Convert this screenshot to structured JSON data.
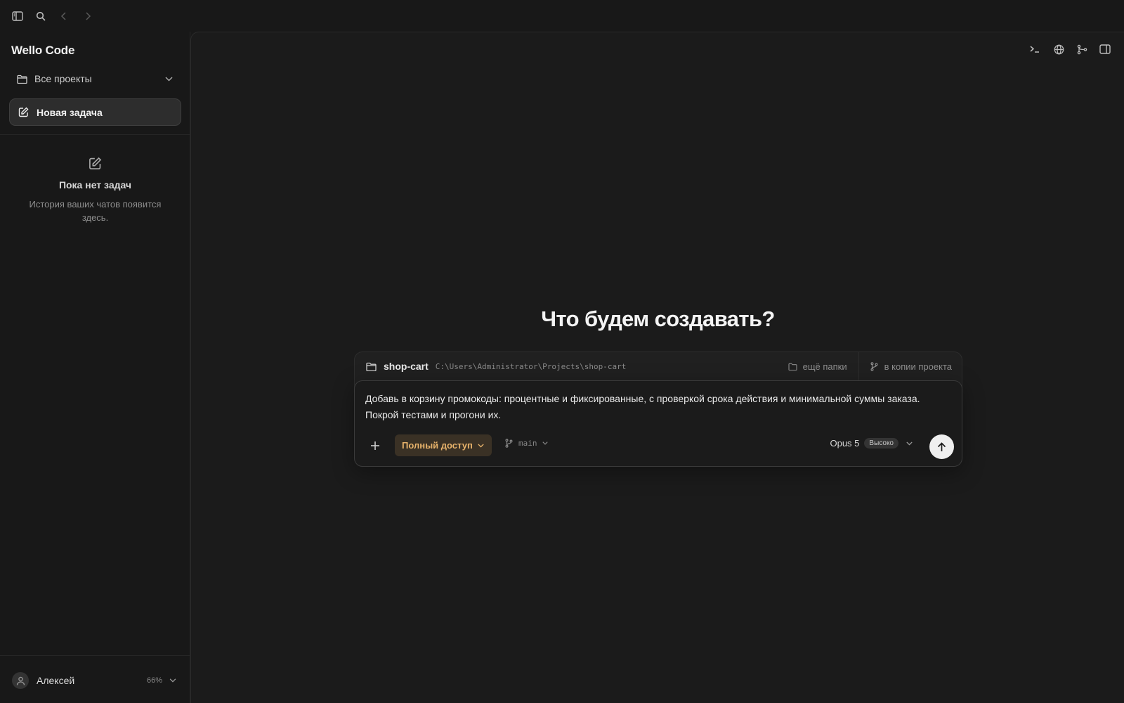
{
  "app": {
    "brand": "Wello Code"
  },
  "topbar": {
    "icons": [
      "sidebar-toggle-icon",
      "search-icon",
      "back-arrow-icon",
      "forward-arrow-icon"
    ]
  },
  "sidebar": {
    "projects_label": "Все проекты",
    "new_task_label": "Новая задача",
    "empty_state": {
      "title": "Пока нет задач",
      "description": "История ваших чатов появится здесь."
    },
    "user": {
      "name": "Алексей",
      "usage": "66%"
    }
  },
  "main": {
    "toolbar_icons": [
      "terminal-icon",
      "globe-icon",
      "git-branch-icon",
      "panel-toggle-icon"
    ],
    "heading": "Что будем создавать?",
    "project": {
      "name": "shop-cart",
      "path": "C:\\Users\\Administrator\\Projects\\shop-cart",
      "more_folders": "ещё папки",
      "copy_mode": "в копии проекта"
    },
    "composer": {
      "prompt": "Добавь в корзину промокоды: процентные и фиксированные, с проверкой срока действия и минимальной суммы заказа. Покрой тестами и прогони их.",
      "access_label": "Полный доступ",
      "branch": "main",
      "model_name": "Opus 5",
      "effort_badge": "Высоко"
    }
  },
  "colors": {
    "background": "#181818",
    "panel": "#1b1b1b",
    "accent_access": "#e8b36b",
    "send_button": "#efefef"
  }
}
